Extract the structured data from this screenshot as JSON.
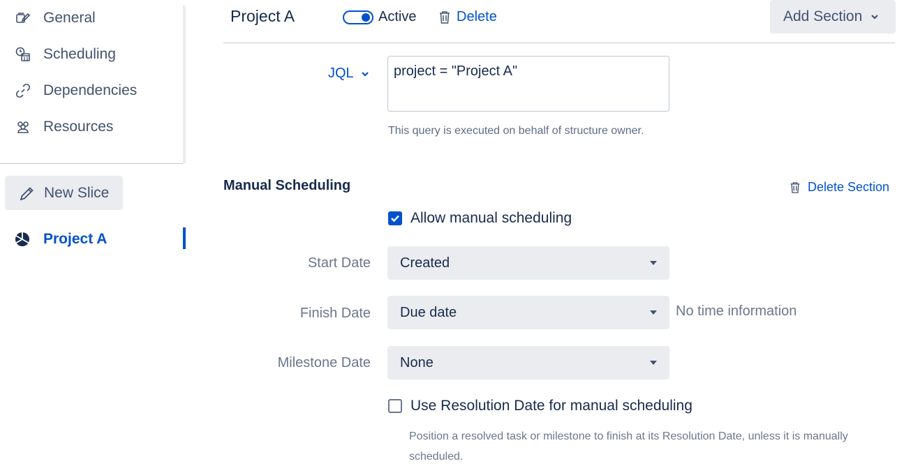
{
  "sidebar": {
    "items": [
      {
        "label": "General",
        "icon": "settings-edit-icon"
      },
      {
        "label": "Scheduling",
        "icon": "calendar-clock-icon"
      },
      {
        "label": "Dependencies",
        "icon": "link-icon"
      },
      {
        "label": "Resources",
        "icon": "people-icon"
      }
    ],
    "new_slice": {
      "label": "New Slice",
      "icon": "pencil-icon"
    },
    "project": {
      "label": "Project A",
      "icon": "pie-chart-icon"
    }
  },
  "header": {
    "title": "Project A",
    "toggle_on": true,
    "active_label": "Active",
    "delete_label": "Delete",
    "add_section_label": "Add Section"
  },
  "jql": {
    "label": "JQL",
    "query": "project = \"Project A\"",
    "help": "This query is executed on behalf of structure owner."
  },
  "manual_scheduling": {
    "title": "Manual Scheduling",
    "delete_section_label": "Delete Section",
    "allow_label": "Allow manual scheduling",
    "allow_checked": true,
    "start_date": {
      "label": "Start Date",
      "value": "Created"
    },
    "finish_date": {
      "label": "Finish Date",
      "value": "Due date",
      "note": "No time information"
    },
    "milestone_date": {
      "label": "Milestone Date",
      "value": "None"
    },
    "resolution_label": "Use Resolution Date for manual scheduling",
    "resolution_checked": false,
    "resolution_desc": "Position a resolved task or milestone to finish at its Resolution Date, unless it is manually scheduled."
  },
  "colors": {
    "accent": "#0052cc",
    "text": "#172b4d",
    "muted": "#6b778c",
    "panel": "#ebecf0"
  }
}
